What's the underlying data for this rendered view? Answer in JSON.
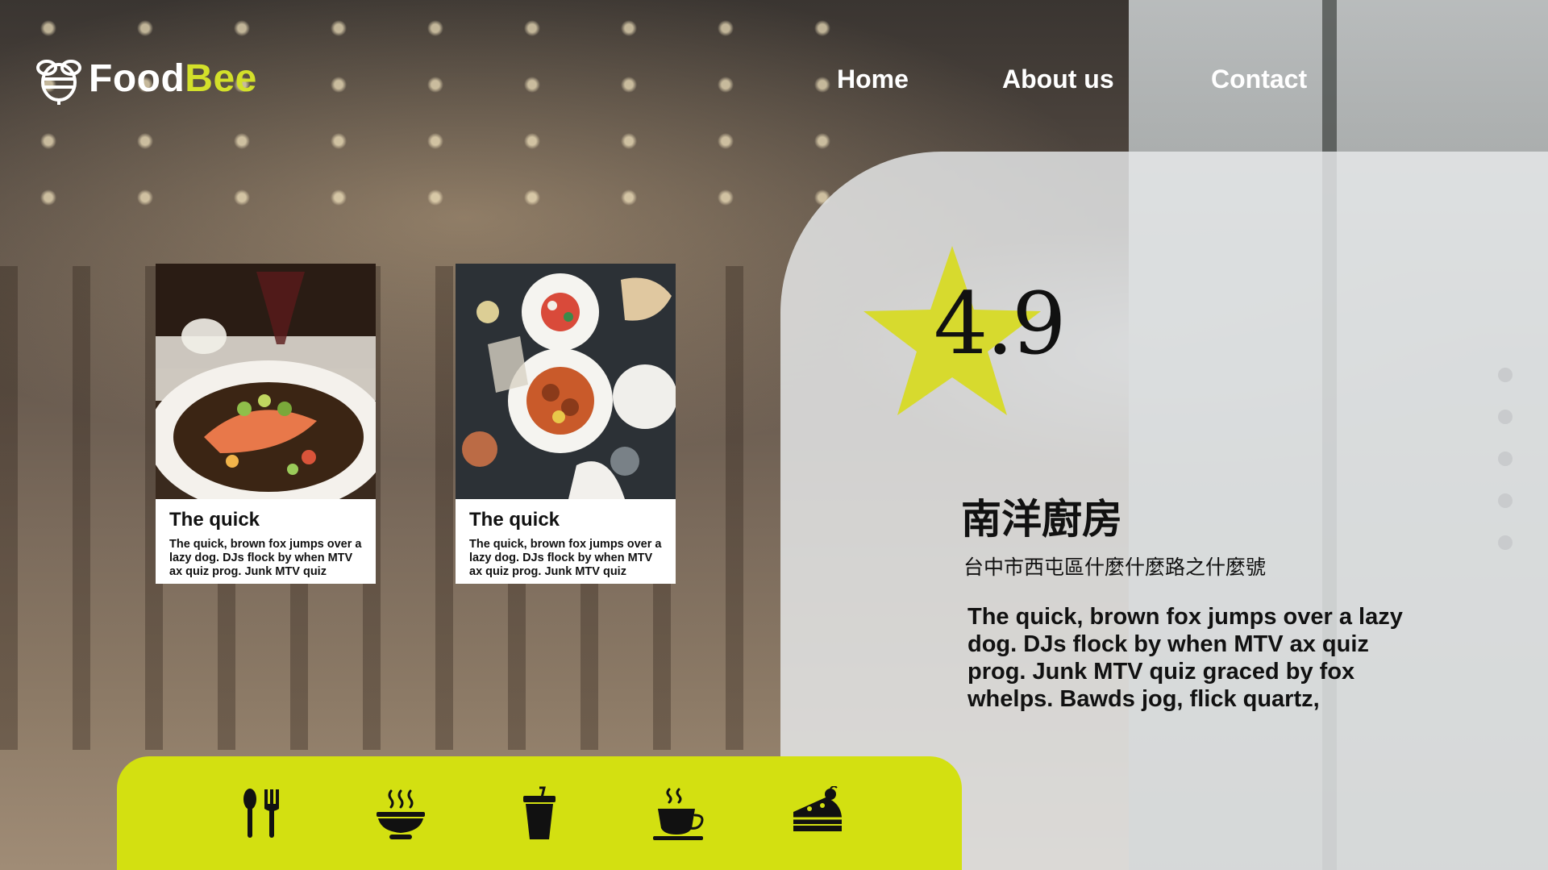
{
  "brand": {
    "name_part1": "Food",
    "name_part2": "Bee"
  },
  "nav": [
    {
      "label": "Home"
    },
    {
      "label": "About us"
    },
    {
      "label": "Contact"
    }
  ],
  "cards": [
    {
      "title": "The quick",
      "description": "The quick, brown fox jumps over a lazy dog. DJs flock by when MTV ax quiz prog. Junk MTV quiz",
      "image_icon": "salmon-dish-photo"
    },
    {
      "title": "The quick",
      "description": "The quick, brown fox jumps over a lazy dog. DJs flock by when MTV ax quiz prog. Junk MTV quiz",
      "image_icon": "table-dishes-photo"
    }
  ],
  "restaurant": {
    "rating": "4.9",
    "name": "南洋廚房",
    "address": "台中市西屯區什麼什麼路之什麼號",
    "description": "The quick, brown fox jumps over a lazy dog. DJs flock by when MTV ax quiz prog. Junk MTV quiz graced by fox whelps. Bawds jog, flick quartz,"
  },
  "pagination": {
    "count": 5
  },
  "categories": [
    {
      "icon": "utensils-icon"
    },
    {
      "icon": "soup-bowl-icon"
    },
    {
      "icon": "drink-cup-icon"
    },
    {
      "icon": "coffee-cup-icon"
    },
    {
      "icon": "cake-icon"
    }
  ],
  "colors": {
    "accent": "#d3e011",
    "star": "#d7da2e",
    "panel": "#e8eaec",
    "text": "#111111",
    "nav_text": "#ffffff"
  }
}
